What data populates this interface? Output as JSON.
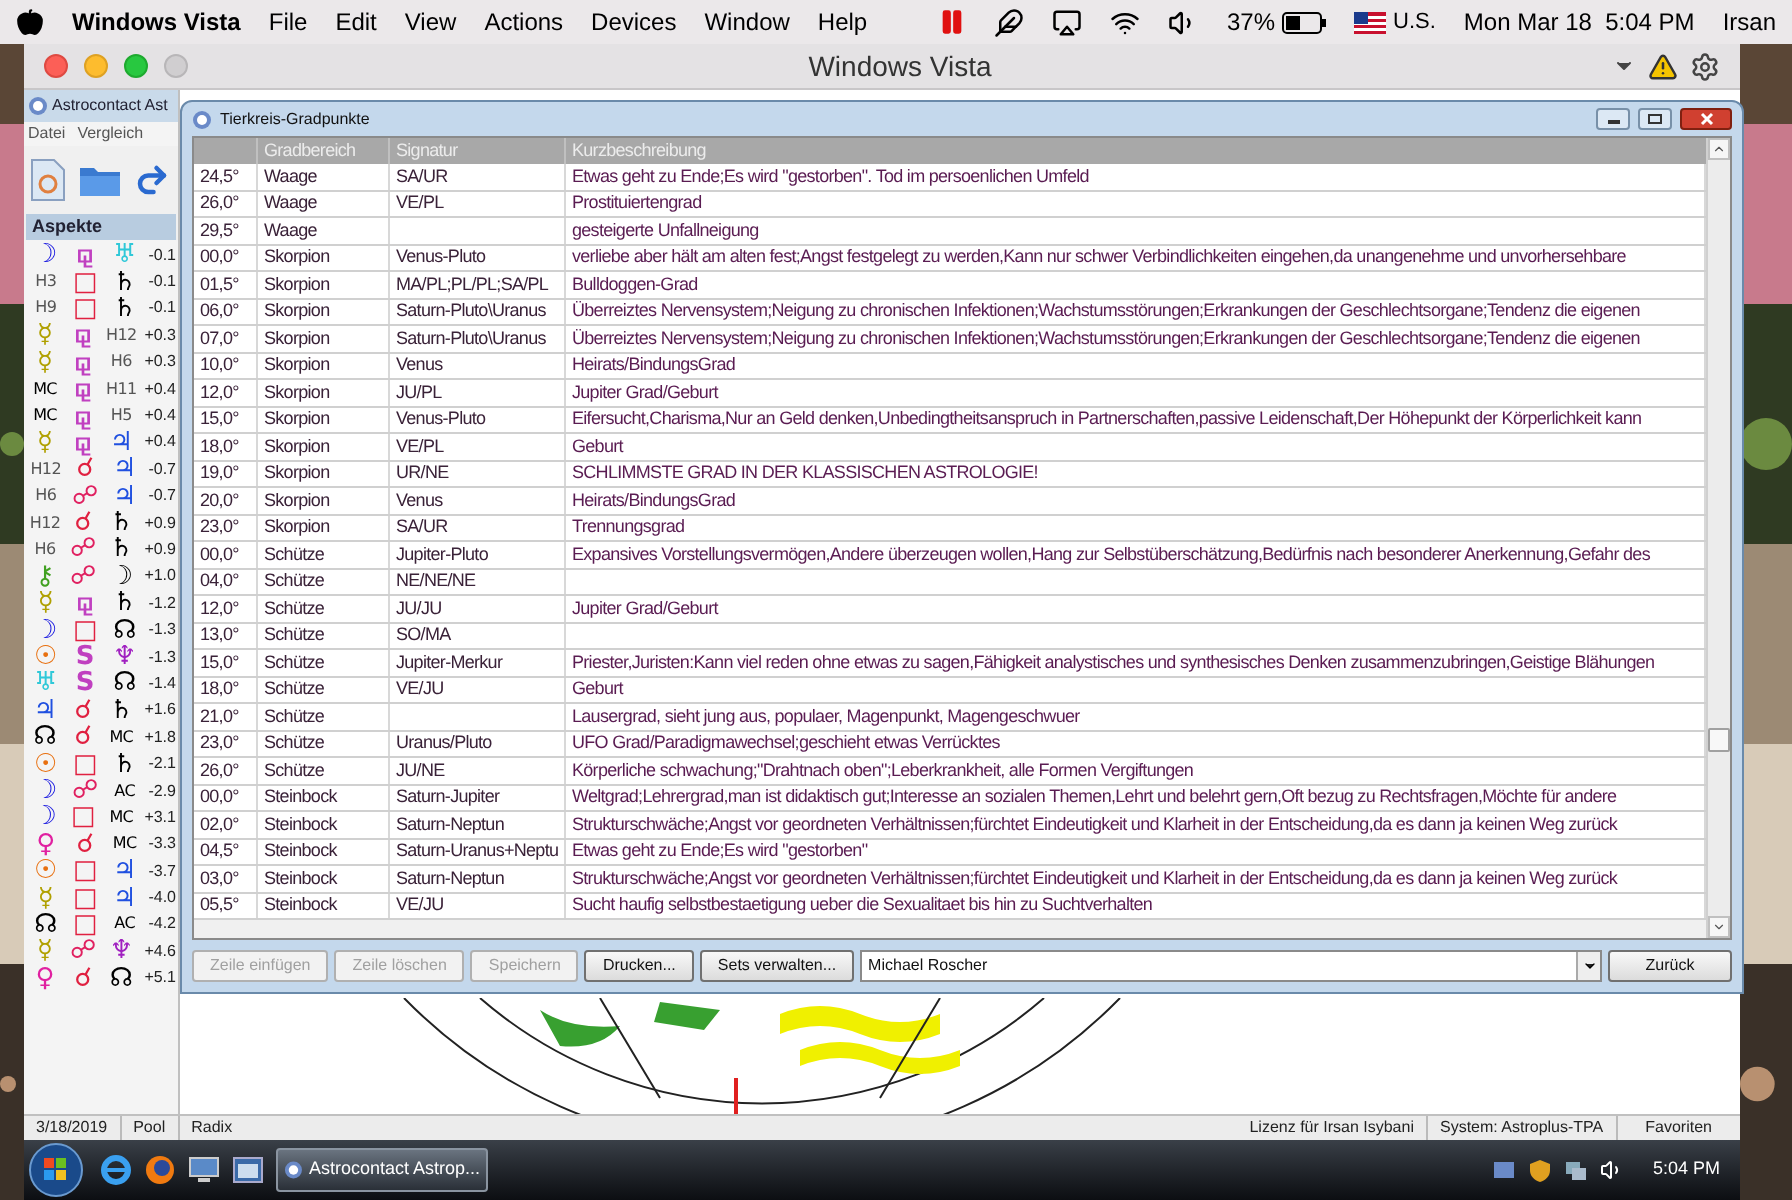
{
  "menu_bar": {
    "app": "Windows Vista",
    "items": [
      "File",
      "Edit",
      "View",
      "Actions",
      "Devices",
      "Window",
      "Help"
    ],
    "battery": "37%",
    "input": "U.S.",
    "clock": "Mon Mar 18  5:04 PM",
    "user": "Irsan"
  },
  "window": {
    "title": "Windows Vista"
  },
  "app": {
    "title": "Astrocontact Ast",
    "menu": [
      "Datei",
      "Vergleich"
    ],
    "panel_title": "Aspekte",
    "aspects": [
      {
        "planet_1": {
          "kind": "symbol",
          "text": "☽",
          "color": "#1a1ae0"
        },
        "aspect": {
          "kind": "symbol",
          "text": "⚼",
          "color": "#c040c0"
        },
        "planet_2": {
          "kind": "symbol",
          "text": "♅",
          "color": "#30c8d8"
        },
        "orb": "-0.1"
      },
      {
        "planet_1": {
          "kind": "label",
          "text": "H3",
          "color": "#555555"
        },
        "aspect": {
          "kind": "symbol",
          "text": "□",
          "color": "#e02040"
        },
        "planet_2": {
          "kind": "symbol",
          "text": "♄",
          "color": "#000000"
        },
        "orb": "-0.1"
      },
      {
        "planet_1": {
          "kind": "label",
          "text": "H9",
          "color": "#555555"
        },
        "aspect": {
          "kind": "symbol",
          "text": "□",
          "color": "#e02040"
        },
        "planet_2": {
          "kind": "symbol",
          "text": "♄",
          "color": "#000000"
        },
        "orb": "-0.1"
      },
      {
        "planet_1": {
          "kind": "symbol",
          "text": "☿",
          "color": "#b0a000"
        },
        "aspect": {
          "kind": "symbol",
          "text": "⚼",
          "color": "#c040c0"
        },
        "planet_2": {
          "kind": "label",
          "text": "H12",
          "color": "#555555"
        },
        "orb": "+0.3"
      },
      {
        "planet_1": {
          "kind": "symbol",
          "text": "☿",
          "color": "#b0a000"
        },
        "aspect": {
          "kind": "symbol",
          "text": "⚼",
          "color": "#c040c0"
        },
        "planet_2": {
          "kind": "label",
          "text": "H6",
          "color": "#555555"
        },
        "orb": "+0.3"
      },
      {
        "planet_1": {
          "kind": "label",
          "text": "MC",
          "color": "#000000"
        },
        "aspect": {
          "kind": "symbol",
          "text": "⚼",
          "color": "#c040c0"
        },
        "planet_2": {
          "kind": "label",
          "text": "H11",
          "color": "#555555"
        },
        "orb": "+0.4"
      },
      {
        "planet_1": {
          "kind": "label",
          "text": "MC",
          "color": "#000000"
        },
        "aspect": {
          "kind": "symbol",
          "text": "⚼",
          "color": "#c040c0"
        },
        "planet_2": {
          "kind": "label",
          "text": "H5",
          "color": "#555555"
        },
        "orb": "+0.4"
      },
      {
        "planet_1": {
          "kind": "symbol",
          "text": "☿",
          "color": "#b0a000"
        },
        "aspect": {
          "kind": "symbol",
          "text": "⚼",
          "color": "#c040c0"
        },
        "planet_2": {
          "kind": "symbol",
          "text": "♃",
          "color": "#2050e0"
        },
        "orb": "+0.4"
      },
      {
        "planet_1": {
          "kind": "label",
          "text": "H12",
          "color": "#555555"
        },
        "aspect": {
          "kind": "symbol",
          "text": "☌",
          "color": "#e02040"
        },
        "planet_2": {
          "kind": "symbol",
          "text": "♃",
          "color": "#2050e0"
        },
        "orb": "-0.7"
      },
      {
        "planet_1": {
          "kind": "label",
          "text": "H6",
          "color": "#555555"
        },
        "aspect": {
          "kind": "symbol",
          "text": "☍",
          "color": "#e02060"
        },
        "planet_2": {
          "kind": "symbol",
          "text": "♃",
          "color": "#2050e0"
        },
        "orb": "-0.7"
      },
      {
        "planet_1": {
          "kind": "label",
          "text": "H12",
          "color": "#555555"
        },
        "aspect": {
          "kind": "symbol",
          "text": "☌",
          "color": "#e02040"
        },
        "planet_2": {
          "kind": "symbol",
          "text": "♄",
          "color": "#000000"
        },
        "orb": "+0.9"
      },
      {
        "planet_1": {
          "kind": "label",
          "text": "H6",
          "color": "#555555"
        },
        "aspect": {
          "kind": "symbol",
          "text": "☍",
          "color": "#e02060"
        },
        "planet_2": {
          "kind": "symbol",
          "text": "♄",
          "color": "#000000"
        },
        "orb": "+0.9"
      },
      {
        "planet_1": {
          "kind": "symbol",
          "text": "⚷",
          "color": "#40a020"
        },
        "aspect": {
          "kind": "symbol",
          "text": "☍",
          "color": "#e02060"
        },
        "planet_2": {
          "kind": "symbol",
          "text": "☽",
          "color": "#000000"
        },
        "orb": "+1.0"
      },
      {
        "planet_1": {
          "kind": "symbol",
          "text": "☿",
          "color": "#b0a000"
        },
        "aspect": {
          "kind": "symbol",
          "text": "⚼",
          "color": "#c040c0"
        },
        "planet_2": {
          "kind": "symbol",
          "text": "♄",
          "color": "#000000"
        },
        "orb": "-1.2"
      },
      {
        "planet_1": {
          "kind": "symbol",
          "text": "☽",
          "color": "#1a1ae0"
        },
        "aspect": {
          "kind": "symbol",
          "text": "□",
          "color": "#e02040"
        },
        "planet_2": {
          "kind": "symbol",
          "text": "☊",
          "color": "#000000"
        },
        "orb": "-1.3"
      },
      {
        "planet_1": {
          "kind": "symbol",
          "text": "☉",
          "color": "#e87010"
        },
        "aspect": {
          "kind": "symbol",
          "text": "S",
          "color": "#c040c0"
        },
        "planet_2": {
          "kind": "symbol",
          "text": "♆",
          "color": "#a020c0"
        },
        "orb": "-1.3"
      },
      {
        "planet_1": {
          "kind": "symbol",
          "text": "♅",
          "color": "#30c8d8"
        },
        "aspect": {
          "kind": "symbol",
          "text": "S",
          "color": "#c040c0"
        },
        "planet_2": {
          "kind": "symbol",
          "text": "☊",
          "color": "#000000"
        },
        "orb": "-1.4"
      },
      {
        "planet_1": {
          "kind": "symbol",
          "text": "♃",
          "color": "#2050e0"
        },
        "aspect": {
          "kind": "symbol",
          "text": "☌",
          "color": "#e02040"
        },
        "planet_2": {
          "kind": "symbol",
          "text": "♄",
          "color": "#000000"
        },
        "orb": "+1.6"
      },
      {
        "planet_1": {
          "kind": "symbol",
          "text": "☊",
          "color": "#000000"
        },
        "aspect": {
          "kind": "symbol",
          "text": "☌",
          "color": "#e02040"
        },
        "planet_2": {
          "kind": "label",
          "text": "MC",
          "color": "#000000"
        },
        "orb": "+1.8"
      },
      {
        "planet_1": {
          "kind": "symbol",
          "text": "☉",
          "color": "#e87010"
        },
        "aspect": {
          "kind": "symbol",
          "text": "□",
          "color": "#e02040"
        },
        "planet_2": {
          "kind": "symbol",
          "text": "♄",
          "color": "#000000"
        },
        "orb": "-2.1"
      },
      {
        "planet_1": {
          "kind": "symbol",
          "text": "☽",
          "color": "#1a1ae0"
        },
        "aspect": {
          "kind": "symbol",
          "text": "☍",
          "color": "#e02060"
        },
        "planet_2": {
          "kind": "label",
          "text": "AC",
          "color": "#000000"
        },
        "orb": "-2.9"
      },
      {
        "planet_1": {
          "kind": "symbol",
          "text": "☽",
          "color": "#1a1ae0"
        },
        "aspect": {
          "kind": "symbol",
          "text": "□",
          "color": "#e02040"
        },
        "planet_2": {
          "kind": "label",
          "text": "MC",
          "color": "#000000"
        },
        "orb": "+3.1"
      },
      {
        "planet_1": {
          "kind": "symbol",
          "text": "♀",
          "color": "#e020a0"
        },
        "aspect": {
          "kind": "symbol",
          "text": "☌",
          "color": "#e02040"
        },
        "planet_2": {
          "kind": "label",
          "text": "MC",
          "color": "#000000"
        },
        "orb": "-3.3"
      },
      {
        "planet_1": {
          "kind": "symbol",
          "text": "☉",
          "color": "#e87010"
        },
        "aspect": {
          "kind": "symbol",
          "text": "□",
          "color": "#e02040"
        },
        "planet_2": {
          "kind": "symbol",
          "text": "♃",
          "color": "#2050e0"
        },
        "orb": "-3.7"
      },
      {
        "planet_1": {
          "kind": "symbol",
          "text": "☿",
          "color": "#b0a000"
        },
        "aspect": {
          "kind": "symbol",
          "text": "□",
          "color": "#e02040"
        },
        "planet_2": {
          "kind": "symbol",
          "text": "♃",
          "color": "#2050e0"
        },
        "orb": "-4.0"
      },
      {
        "planet_1": {
          "kind": "symbol",
          "text": "☊",
          "color": "#000000"
        },
        "aspect": {
          "kind": "symbol",
          "text": "□",
          "color": "#e02040"
        },
        "planet_2": {
          "kind": "label",
          "text": "AC",
          "color": "#000000"
        },
        "orb": "-4.2"
      },
      {
        "planet_1": {
          "kind": "symbol",
          "text": "☿",
          "color": "#b0a000"
        },
        "aspect": {
          "kind": "symbol",
          "text": "☍",
          "color": "#e02060"
        },
        "planet_2": {
          "kind": "symbol",
          "text": "♆",
          "color": "#a020c0"
        },
        "orb": "+4.6"
      },
      {
        "planet_1": {
          "kind": "symbol",
          "text": "♀",
          "color": "#e020a0"
        },
        "aspect": {
          "kind": "symbol",
          "text": "☌",
          "color": "#e02040"
        },
        "planet_2": {
          "kind": "symbol",
          "text": "☊",
          "color": "#000000"
        },
        "orb": "+5.1"
      }
    ]
  },
  "dialog": {
    "title": "Tierkreis-Gradpunkte",
    "columns": [
      "Gradbereich",
      "Signatur",
      "Kurzbeschreibung"
    ],
    "rows": [
      {
        "degree": "24,5°",
        "sign": "Waage",
        "signature": "SA/UR",
        "description": "Etwas geht zu Ende;Es wird \"gestorben\". Tod im persoenlichen Umfeld"
      },
      {
        "degree": "26,0°",
        "sign": "Waage",
        "signature": "VE/PL",
        "description": "Prostituiertengrad"
      },
      {
        "degree": "29,5°",
        "sign": "Waage",
        "description": "gesteigerte Unfallneigung"
      },
      {
        "degree": "00,0°",
        "sign": "Skorpion",
        "signature": "Venus-Pluto",
        "description": "verliebe aber hält am alten fest;Angst festgelegt zu werden,Kann nur schwer Verbindlichkeiten eingehen,da unangenehme und unvorhersehbare"
      },
      {
        "degree": "01,5°",
        "sign": "Skorpion",
        "signature": "MA/PL;PL/PL;SA/PL",
        "description": "Bulldoggen-Grad"
      },
      {
        "degree": "06,0°",
        "sign": "Skorpion",
        "signature": "Saturn-Pluto\\Uranus",
        "description": "Überreiztes Nervensystem;Neigung zu chronischen Infektionen;Wachstumsstörungen;Erkrankungen der Geschlechtsorgane;Tendenz die eigenen"
      },
      {
        "degree": "07,0°",
        "sign": "Skorpion",
        "signature": "Saturn-Pluto\\Uranus",
        "description": "Überreiztes Nervensystem;Neigung zu chronischen Infektionen;Wachstumsstörungen;Erkrankungen der Geschlechtsorgane;Tendenz die eigenen"
      },
      {
        "degree": "10,0°",
        "sign": "Skorpion",
        "signature": "Venus",
        "description": "Heirats/BindungsGrad"
      },
      {
        "degree": "12,0°",
        "sign": "Skorpion",
        "signature": "JU/PL",
        "description": "Jupiter Grad/Geburt"
      },
      {
        "degree": "15,0°",
        "sign": "Skorpion",
        "signature": "Venus-Pluto",
        "description": "Eifersucht,Charisma,Nur an Geld denken,Unbedingtheitsanspruch in Partnerschaften,passive Leidenschaft,Der Höhepunkt der Körperlichkeit kann"
      },
      {
        "degree": "18,0°",
        "sign": "Skorpion",
        "signature": "VE/PL",
        "description": "Geburt"
      },
      {
        "degree": "19,0°",
        "sign": "Skorpion",
        "signature": "UR/NE",
        "description": "SCHLIMMSTE GRAD IN DER KLASSISCHEN ASTROLOGIE!"
      },
      {
        "degree": "20,0°",
        "sign": "Skorpion",
        "signature": "Venus",
        "description": "Heirats/BindungsGrad"
      },
      {
        "degree": "23,0°",
        "sign": "Skorpion",
        "signature": "SA/UR",
        "description": "Trennungsgrad"
      },
      {
        "degree": "00,0°",
        "sign": "Schütze",
        "signature": "Jupiter-Pluto",
        "description": "Expansives Vorstellungsvermögen,Andere überzeugen wollen,Hang zur Selbstüberschätzung,Bedürfnis nach besonderer Anerkennung,Gefahr des"
      },
      {
        "degree": "04,0°",
        "sign": "Schütze",
        "signature": "NE/NE/NE"
      },
      {
        "degree": "12,0°",
        "sign": "Schütze",
        "signature": "JU/JU",
        "description": "Jupiter Grad/Geburt"
      },
      {
        "degree": "13,0°",
        "sign": "Schütze",
        "signature": "SO/MA"
      },
      {
        "degree": "15,0°",
        "sign": "Schütze",
        "signature": "Jupiter-Merkur",
        "description": "Priester,Juristen:Kann viel reden ohne etwas zu sagen,Fähigkeit analystisches und synthesisches Denken zusammenzubringen,Geistige Blähungen"
      },
      {
        "degree": "18,0°",
        "sign": "Schütze",
        "signature": "VE/JU",
        "description": "Geburt"
      },
      {
        "degree": "21,0°",
        "sign": "Schütze",
        "description": "Lausergrad, sieht jung aus, populaer, Magenpunkt, Magengeschwuer"
      },
      {
        "degree": "23,0°",
        "sign": "Schütze",
        "signature": "Uranus/Pluto",
        "description": "UFO Grad/Paradigmawechsel;geschieht etwas Verrücktes"
      },
      {
        "degree": "26,0°",
        "sign": "Schütze",
        "signature": "JU/NE",
        "description": "Körperliche schwachung;\"Drahtnach oben\";Leberkrankheit, alle Formen Vergiftungen"
      },
      {
        "degree": "00,0°",
        "sign": "Steinbock",
        "signature": "Saturn-Jupiter",
        "description": "Weltgrad;Lehrergrad,man ist didaktisch gut;Interesse an sozialen Themen,Lehrt und belehrt gern,Oft bezug zu Rechtsfragen,Möchte für andere"
      },
      {
        "degree": "02,0°",
        "sign": "Steinbock",
        "signature": "Saturn-Neptun",
        "description": "Strukturschwäche;Angst vor geordneten Verhältnissen;fürchtet Eindeutigkeit und Klarheit in der Entscheidung,da es dann ja keinen Weg zurück"
      },
      {
        "degree": "04,5°",
        "sign": "Steinbock",
        "signature": "Saturn-Uranus+Neptu",
        "description": "Etwas geht zu Ende;Es wird \"gestorben\""
      },
      {
        "degree": "03,0°",
        "sign": "Steinbock",
        "signature": "Saturn-Neptun",
        "description": "Strukturschwäche;Angst vor geordneten Verhältnissen;fürchtet Eindeutigkeit und Klarheit in der Entscheidung,da es dann ja keinen Weg zurück"
      },
      {
        "degree": "05,5°",
        "sign": "Steinbock",
        "signature": "VE/JU",
        "description": "Sucht haufig selbstbestaetigung ueber die Sexualitaet bis hin zu Suchtverhalten"
      }
    ],
    "buttons": [
      {
        "label": "Zeile einfügen",
        "disabled": true
      },
      {
        "label": "Zeile löschen",
        "disabled": true
      },
      {
        "label": "Speichern",
        "disabled": true
      },
      {
        "label": "Drucken...",
        "disabled": false
      },
      {
        "label": "Sets verwalten...",
        "disabled": false
      }
    ],
    "set_dropdown": {
      "value": "Michael Roscher"
    },
    "back_button": "Zurück"
  },
  "status_bar": {
    "date": "3/18/2019",
    "pool": "Pool",
    "mode": "Radix",
    "license": "Lizenz für Irsan Isybani",
    "system": "System: Astroplus-TPA",
    "favorites": "Favoriten"
  },
  "taskbar": {
    "task": "Astrocontact Astrop...",
    "clock": "5:04 PM"
  }
}
